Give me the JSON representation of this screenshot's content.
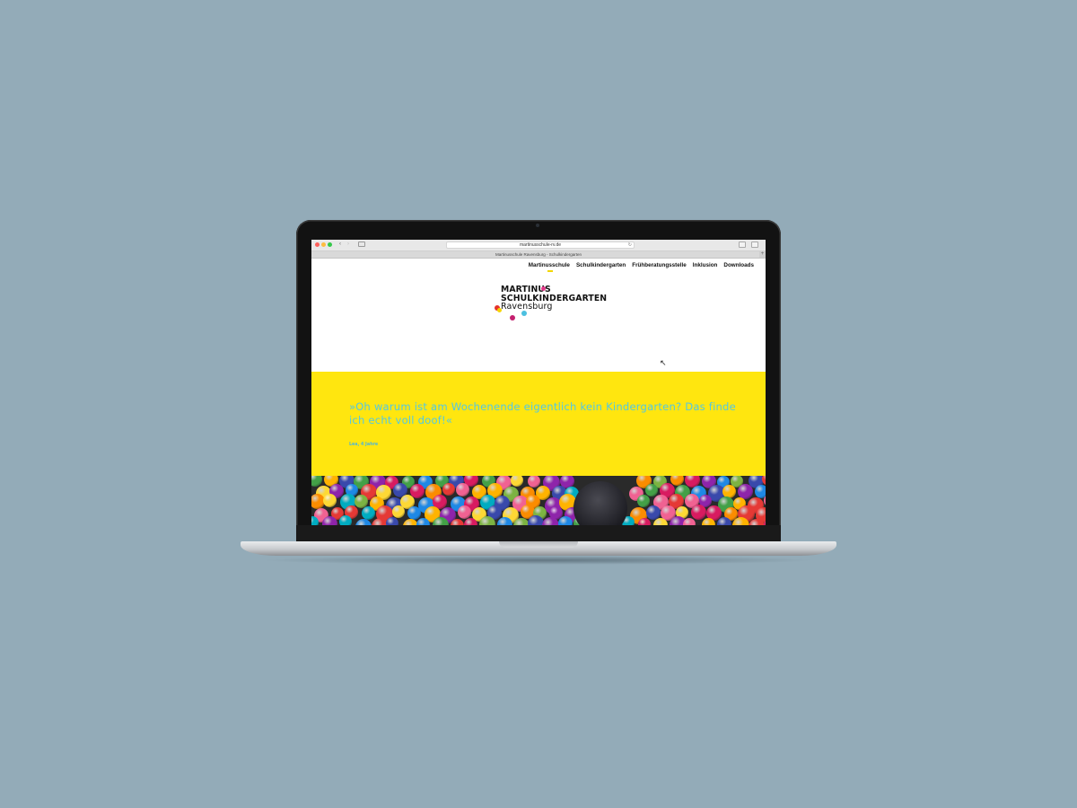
{
  "browser": {
    "url": "martinusschule-rv.de",
    "tab_title": "Martinusschule Ravensburg - Schulkindergarten",
    "new_tab_symbol": "+"
  },
  "site": {
    "nav": [
      "Martinusschule",
      "Schulkindergarten",
      "Frühberatungsstelle",
      "Inklusion",
      "Downloads"
    ],
    "logo": {
      "line1": "MARTINUS",
      "line2": "SCHULKINDERGARTEN",
      "line3": "Ravensburg"
    },
    "quote": {
      "text": "»Oh warum ist am Wochenende eigentlich kein Kindergarten? Das finde ich echt voll doof!«",
      "author": "Lea, 4 Jahre"
    }
  },
  "colors": {
    "background": "#93abb8",
    "quote_band": "#ffe60f",
    "quote_text": "#52c7e4",
    "active_nav_marker": "#f2d600"
  },
  "icons": {
    "back": "chevron-left-icon",
    "forward": "chevron-right-icon",
    "reload": "reload-icon",
    "share": "share-icon",
    "tabs": "tabs-icon",
    "cursor": "cursor-icon"
  }
}
